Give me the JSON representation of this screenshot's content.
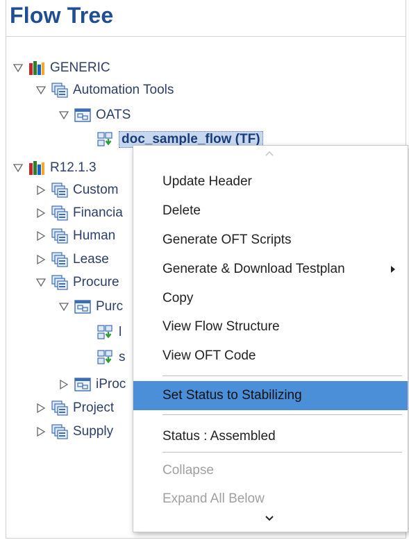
{
  "panel": {
    "title": "Flow Tree"
  },
  "tree": {
    "generic": "GENERIC",
    "automation_tools": "Automation Tools",
    "oats": "OATS",
    "doc_sample_flow": "doc_sample_flow (TF)",
    "r12": "R12.1.3",
    "custom": "Custom",
    "financial": "Financia",
    "human": "Human",
    "lease": "Lease",
    "procure": "Procure",
    "purc": "Purc",
    "flow_l": "l",
    "flow_s": "s",
    "iproc": "iProc",
    "projects": "Project",
    "supply": "Supply"
  },
  "menu": {
    "items": [
      "Update Header",
      "Delete",
      "Generate OFT Scripts",
      "Generate & Download Testplan",
      "Copy",
      "View Flow Structure",
      "View OFT Code",
      "Set Status to Stabilizing",
      "Status : Assembled",
      "Collapse",
      "Expand All Below"
    ]
  },
  "icons": {
    "expanded": "triangle-down-icon",
    "collapsed": "triangle-right-icon",
    "library": "books-icon",
    "folder_stack": "folder-stack-icon",
    "module": "module-icon",
    "flow": "flow-icon"
  },
  "colors": {
    "title": "#1f4e93",
    "highlight": "#4b8fd9",
    "selection": "#c7d7ee"
  }
}
